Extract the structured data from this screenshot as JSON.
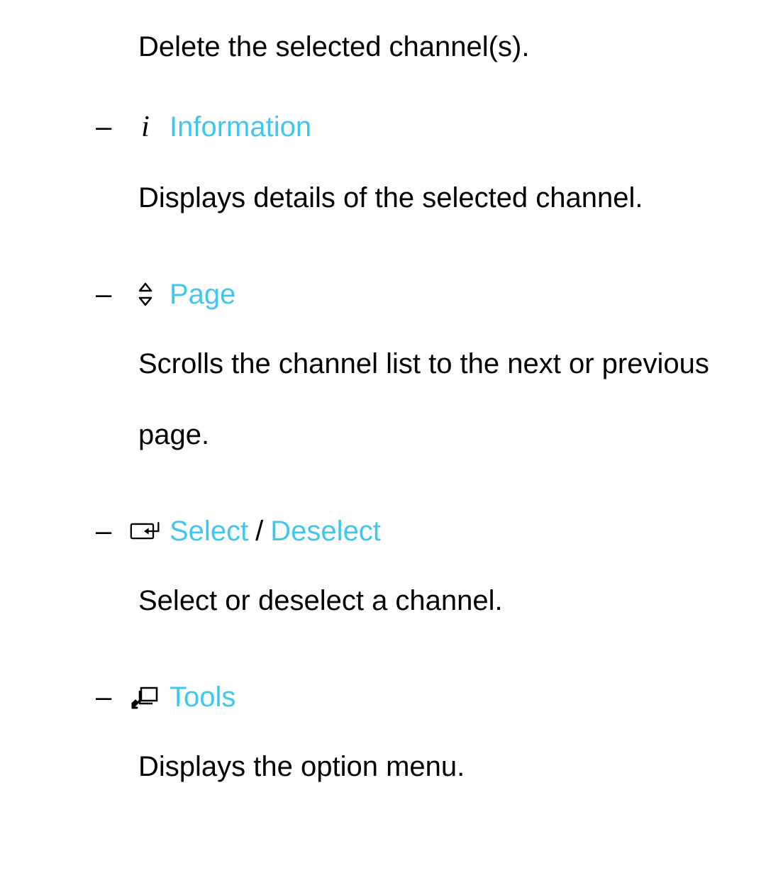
{
  "intro": "Delete the selected channel(s).",
  "items": [
    {
      "icon": "info",
      "label": "Information",
      "desc": "Displays details of the selected channel."
    },
    {
      "icon": "page",
      "label": "Page",
      "desc": "Scrolls the channel list to the next or previous page."
    },
    {
      "icon": "enter",
      "label": "Select",
      "label2": "Deselect",
      "sep": "/",
      "desc": "Select or deselect a channel."
    },
    {
      "icon": "tools",
      "label": "Tools",
      "desc": "Displays the option menu."
    }
  ]
}
